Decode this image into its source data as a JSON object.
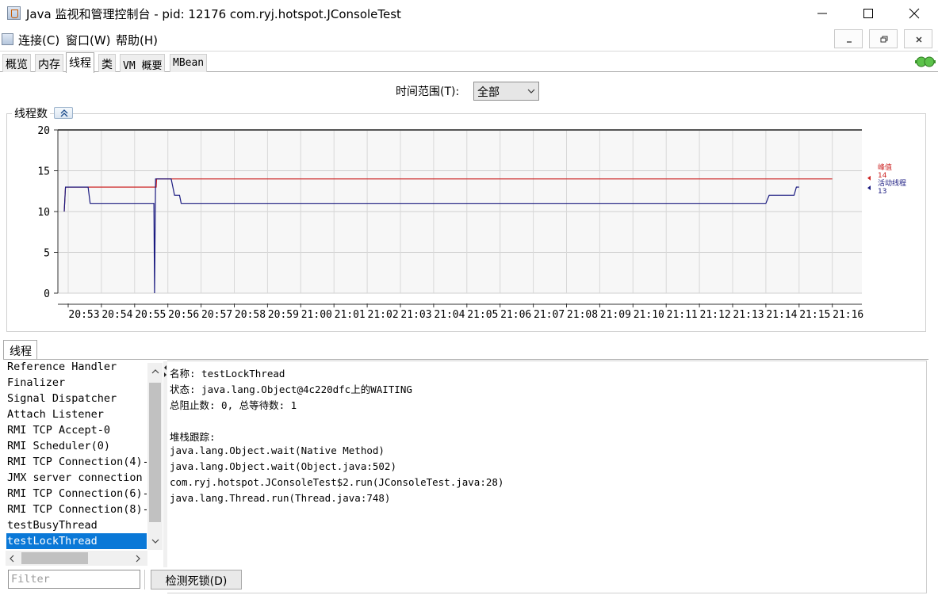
{
  "window": {
    "title": "Java 监视和管理控制台 - pid: 12176 com.ryj.hotspot.JConsoleTest",
    "icon": "java-icon"
  },
  "menu": {
    "items": [
      {
        "label": "连接(C)"
      },
      {
        "label": "窗口(W)"
      },
      {
        "label": "帮助(H)"
      }
    ]
  },
  "tabs": [
    {
      "label": "概览",
      "active": false
    },
    {
      "label": "内存",
      "active": false
    },
    {
      "label": "线程",
      "active": true
    },
    {
      "label": "类",
      "active": false
    },
    {
      "label": "VM 概要",
      "active": false
    },
    {
      "label": "MBean",
      "active": false
    }
  ],
  "time_range": {
    "label": "时间范围(T):",
    "selected": "全部"
  },
  "chart_panel": {
    "title": "线程数"
  },
  "chart_data": {
    "type": "line",
    "ylim": [
      0,
      20
    ],
    "yticks": [
      0,
      5,
      10,
      15,
      20
    ],
    "x_ticks": [
      "20:53",
      "20:54",
      "20:55",
      "20:56",
      "20:57",
      "20:58",
      "20:59",
      "21:00",
      "21:01",
      "21:02",
      "21:03",
      "21:04",
      "21:05",
      "21:06",
      "21:07",
      "21:08",
      "21:09",
      "21:10",
      "21:11",
      "21:12",
      "21:13",
      "21:14",
      "21:15",
      "21:16"
    ],
    "grid": true,
    "legend_position": "right",
    "series": [
      {
        "name": "峰值",
        "color": "#cc2222",
        "current": 14,
        "points": [
          [
            -0.12,
            10
          ],
          [
            -0.08,
            13
          ],
          [
            2.65,
            13
          ],
          [
            2.66,
            14
          ],
          [
            23.0,
            14
          ]
        ]
      },
      {
        "name": "活动线程",
        "color": "#1a1a80",
        "current": 13,
        "points": [
          [
            -0.12,
            10
          ],
          [
            -0.08,
            13
          ],
          [
            0.6,
            13
          ],
          [
            0.66,
            11
          ],
          [
            2.58,
            11
          ],
          [
            2.6,
            0
          ],
          [
            2.63,
            14
          ],
          [
            3.1,
            14
          ],
          [
            3.2,
            12
          ],
          [
            3.35,
            12
          ],
          [
            3.4,
            11
          ],
          [
            21.0,
            11
          ],
          [
            21.1,
            12
          ],
          [
            21.85,
            12
          ],
          [
            21.92,
            13
          ],
          [
            22.0,
            13
          ]
        ]
      }
    ]
  },
  "threads_tab": {
    "label": "线程"
  },
  "thread_list": [
    "Reference Handler",
    "Finalizer",
    "Signal Dispatcher",
    "Attach Listener",
    "RMI TCP Accept-0",
    "RMI Scheduler(0)",
    "RMI TCP Connection(4)-",
    "JMX server connection",
    "RMI TCP Connection(6)-",
    "RMI TCP Connection(8)-",
    "testBusyThread",
    "testLockThread"
  ],
  "selected_thread_index": 11,
  "thread_detail": {
    "name_line": "名称: testLockThread",
    "state_line": "状态: java.lang.Object@4c220dfc上的WAITING",
    "counts_line": "总阻止数: 0, 总等待数: 1",
    "stack_header": "堆栈跟踪:",
    "stack": [
      "java.lang.Object.wait(Native Method)",
      "java.lang.Object.wait(Object.java:502)",
      "com.ryj.hotspot.JConsoleTest$2.run(JConsoleTest.java:28)",
      "java.lang.Thread.run(Thread.java:748)"
    ]
  },
  "filter": {
    "placeholder": "Filter"
  },
  "deadlock_button": {
    "label": "检测死锁(D)"
  }
}
